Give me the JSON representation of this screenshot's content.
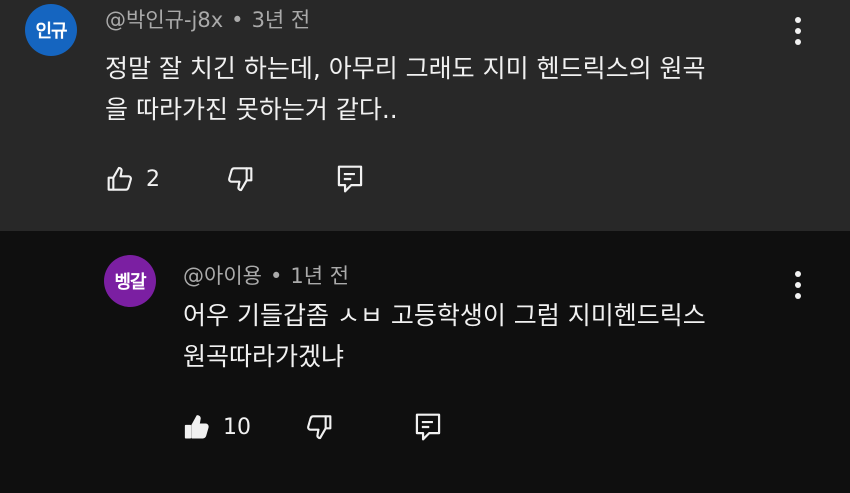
{
  "comments": [
    {
      "avatar_text": "인규",
      "avatar_color": "#1565c0",
      "author": "@박인규-j8x",
      "time": "3년 전",
      "text_lines": [
        "정말 잘 치긴 하는데, 아무리 그래도 지미 헨드릭스의 원곡",
        "을 따라가진 못하는거 같다.."
      ],
      "like_count": "2",
      "liked": false,
      "icons": {
        "like": "thumb-up-icon",
        "dislike": "thumb-down-icon",
        "reply": "reply-icon",
        "more": "more-vert-icon"
      }
    },
    {
      "avatar_text": "벵갈",
      "avatar_color": "#7b1fa2",
      "author": "@아이용",
      "time": "1년 전",
      "text_lines": [
        "어우 기들갑좀 ㅅㅂ 고등학생이 그럼 지미헨드릭스",
        "원곡따라가겠냐"
      ],
      "like_count": "10",
      "liked": true,
      "icons": {
        "like": "thumb-up-filled-icon",
        "dislike": "thumb-down-icon",
        "reply": "reply-icon",
        "more": "more-vert-icon"
      }
    }
  ],
  "colors": {
    "parent_background": "#282828",
    "reply_background": "#0f0f0f",
    "primary_text": "#f1f1f1",
    "secondary_text": "#aaaaaa"
  }
}
